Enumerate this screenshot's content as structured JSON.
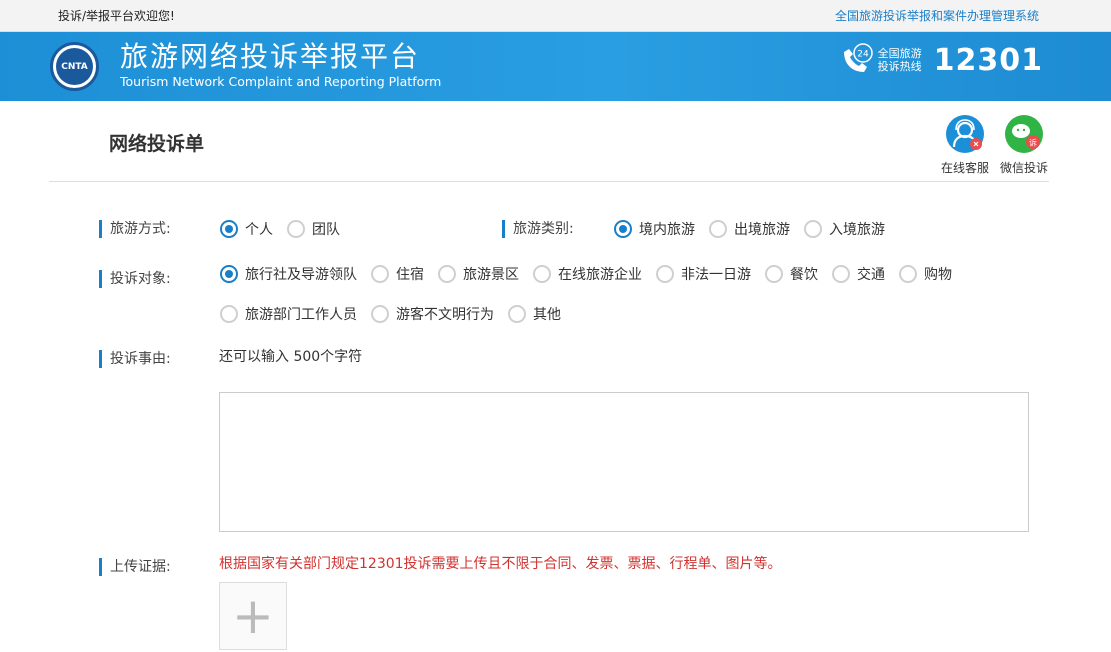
{
  "topbar": {
    "welcome": "投诉/举报平台欢迎您!",
    "system_link": "全国旅游投诉举报和案件办理管理系统"
  },
  "banner": {
    "logo_text": "CNTA",
    "title_cn": "旅游网络投诉举报平台",
    "title_en": "Tourism Network Complaint and Reporting Platform",
    "hotline_badge": "24",
    "hotline_line1": "全国旅游",
    "hotline_line2": "投诉热线",
    "hotline_number": "12301"
  },
  "page": {
    "title": "网络投诉单",
    "online_service": "在线客服",
    "wechat_complaint": "微信投诉",
    "wechat_badge": "诉"
  },
  "form": {
    "travel_mode": {
      "label": "旅游方式:",
      "options": [
        "个人",
        "团队"
      ],
      "selected": "个人"
    },
    "travel_type": {
      "label": "旅游类别:",
      "options": [
        "境内旅游",
        "出境旅游",
        "入境旅游"
      ],
      "selected": "境内旅游"
    },
    "complaint_target": {
      "label": "投诉对象:",
      "options": [
        "旅行社及导游领队",
        "住宿",
        "旅游景区",
        "在线旅游企业",
        "非法一日游",
        "餐饮",
        "交通",
        "购物",
        "旅游部门工作人员",
        "游客不文明行为",
        "其他"
      ],
      "selected": "旅行社及导游领队"
    },
    "reason": {
      "label": "投诉事由:",
      "hint": "还可以输入 500个字符",
      "value": ""
    },
    "evidence": {
      "label": "上传证据:",
      "note": "根据国家有关部门规定12301投诉需要上传且不限于合同、发票、票据、行程单、图片等。",
      "add_symbol": "+"
    }
  },
  "colors": {
    "brand_blue": "#1d8fd6",
    "accent_blue": "#1a7fc9",
    "wechat_green": "#2fb445",
    "warning_red": "#d0332f"
  }
}
